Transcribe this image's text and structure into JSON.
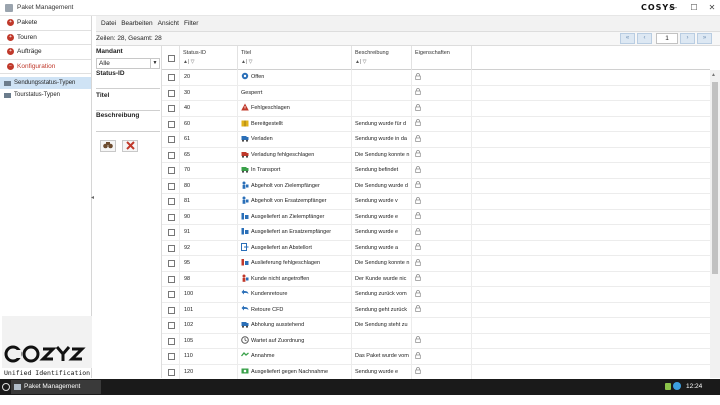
{
  "window": {
    "title": "Paket Management",
    "brand_small": "COSYS",
    "min": "—",
    "max": "☐",
    "close": "✕"
  },
  "sidebar": {
    "items": [
      {
        "label": "Pakete",
        "active": false
      },
      {
        "label": "Touren",
        "active": false
      },
      {
        "label": "Aufträge",
        "active": false
      },
      {
        "label": "Konfiguration",
        "active": true
      }
    ],
    "subitems": [
      {
        "label": "Sendungsstatus-Typen",
        "selected": true
      },
      {
        "label": "Tourstatus-Typen",
        "selected": false
      }
    ],
    "brand_tagline": "Unified Identification"
  },
  "menu": {
    "items": [
      "Datei",
      "Bearbeiten",
      "Ansicht",
      "Filter"
    ]
  },
  "info": {
    "count_text": "Zeilen: 28, Gesamt: 28",
    "page": "1"
  },
  "filter": {
    "mandant_label": "Mandant",
    "mandant_value": "Alle",
    "status_label": "Status-ID",
    "title_label": "Titel",
    "desc_label": "Beschreibung"
  },
  "grid": {
    "headers": {
      "status": "Status-ID",
      "title": "Titel",
      "desc": "Beschreibung",
      "props": "Eigenschaften"
    },
    "rows": [
      {
        "id": "20",
        "title": "Offen",
        "desc": "",
        "icon": "gear-icon",
        "color": "#2a6fb8",
        "lock": true
      },
      {
        "id": "30",
        "title": "Gesperrt",
        "desc": "",
        "icon": "none",
        "color": "#ffffff",
        "lock": true
      },
      {
        "id": "40",
        "title": "Fehlgeschlagen",
        "desc": "",
        "icon": "warning-icon",
        "color": "#c0392b",
        "lock": true
      },
      {
        "id": "60",
        "title": "Bereitgestellt",
        "desc": "Sendung wurde für d",
        "icon": "package-icon",
        "color": "#e0b21a",
        "lock": true
      },
      {
        "id": "61",
        "title": "Verladen",
        "desc": "Sendung wurde in da",
        "icon": "truck-load-icon",
        "color": "#2a6fb8",
        "lock": true
      },
      {
        "id": "65",
        "title": "Verladung fehlgeschlagen",
        "desc": "Die Sendung konnte n",
        "icon": "truck-error-icon",
        "color": "#c0392b",
        "lock": true
      },
      {
        "id": "70",
        "title": "In Transport",
        "desc": "Sendung befindet",
        "icon": "truck-icon",
        "color": "#3aa14a",
        "lock": true
      },
      {
        "id": "80",
        "title": "Abgeholt von Zielempfänger",
        "desc": "Die Sendung wurde d",
        "icon": "person-icon",
        "color": "#2a6fb8",
        "lock": true
      },
      {
        "id": "81",
        "title": "Abgeholt von Ersatzempfänger",
        "desc": "Sendung wurde v",
        "icon": "person-icon",
        "color": "#2a6fb8",
        "lock": true
      },
      {
        "id": "90",
        "title": "Ausgeliefert an Zielempfänger",
        "desc": "Sendung wurde e",
        "icon": "delivery-icon",
        "color": "#2a6fb8",
        "lock": true
      },
      {
        "id": "91",
        "title": "Ausgeliefert an Ersatzempfänger",
        "desc": "Sendung wurde e",
        "icon": "delivery-icon",
        "color": "#2a6fb8",
        "lock": true
      },
      {
        "id": "92",
        "title": "Ausgeliefert an Abstellort",
        "desc": "Sendung wurde a",
        "icon": "dropoff-icon",
        "color": "#2a6fb8",
        "lock": true
      },
      {
        "id": "95",
        "title": "Auslieferung fehlgeschlagen",
        "desc": "Die Sendung konnte n",
        "icon": "delivery-error-icon",
        "color": "#c0392b",
        "lock": true
      },
      {
        "id": "98",
        "title": "Kunde nicht angetroffen",
        "desc": "Der Kunde wurde nic",
        "icon": "person-error-icon",
        "color": "#c0392b",
        "lock": true
      },
      {
        "id": "100",
        "title": "Kundenretoure",
        "desc": "Sendung zurück vom",
        "icon": "return-icon",
        "color": "#2a6fb8",
        "lock": true
      },
      {
        "id": "101",
        "title": "Retoure CFD",
        "desc": "Sendung geht zurück",
        "icon": "return-icon",
        "color": "#2a6fb8",
        "lock": true
      },
      {
        "id": "102",
        "title": "Abholung ausstehend",
        "desc": "Die Sendung steht zu",
        "icon": "truck-icon",
        "color": "#2a6fb8",
        "lock": false
      },
      {
        "id": "105",
        "title": "Wartet auf Zuordnung",
        "desc": "",
        "icon": "clock-icon",
        "color": "#555555",
        "lock": true
      },
      {
        "id": "110",
        "title": "Annahme",
        "desc": "Das Paket wurde vom",
        "icon": "accept-icon",
        "color": "#3aa14a",
        "lock": true
      },
      {
        "id": "120",
        "title": "Ausgeliefert gegen Nachnahme",
        "desc": "Sendung wurde e",
        "icon": "money-icon",
        "color": "#3aa14a",
        "lock": true
      }
    ]
  },
  "taskbar": {
    "task_label": "Paket Management",
    "clock": "12:24"
  }
}
